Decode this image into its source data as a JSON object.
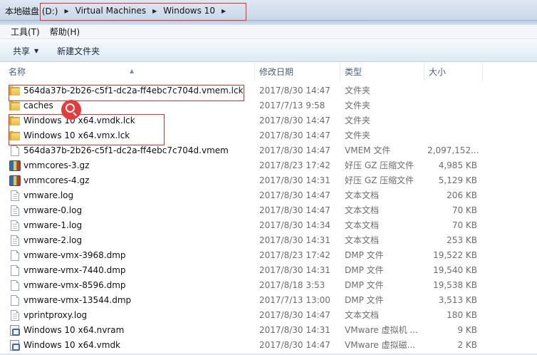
{
  "address": {
    "crumbs": [
      "本地磁盘 (D:)",
      "Virtual Machines",
      "Windows 10"
    ]
  },
  "menu": {
    "items": [
      "工具(T)",
      "帮助(H)"
    ]
  },
  "toolbar": {
    "share_label": "共享",
    "new_folder_label": "新建文件夹"
  },
  "columns": {
    "name": "名称",
    "date": "修改日期",
    "type": "类型",
    "size": "大小"
  },
  "files": [
    {
      "name": "564da37b-2b26-c5f1-dc2a-ff4ebc7c704d.vmem.lck",
      "date": "2017/8/30 14:47",
      "type": "文件夹",
      "size": "",
      "icon": "folder-icon"
    },
    {
      "name": "caches",
      "date": "2017/7/13 9:58",
      "type": "文件夹",
      "size": "",
      "icon": "folder-icon"
    },
    {
      "name": "Windows 10 x64.vmdk.lck",
      "date": "2017/8/30 14:47",
      "type": "文件夹",
      "size": "",
      "icon": "folder-icon"
    },
    {
      "name": "Windows 10 x64.vmx.lck",
      "date": "2017/8/30 14:47",
      "type": "文件夹",
      "size": "",
      "icon": "folder-icon"
    },
    {
      "name": "564da37b-2b26-c5f1-dc2a-ff4ebc7c704d.vmem",
      "date": "2017/8/30 14:47",
      "type": "VMEM 文件",
      "size": "2,097,152...",
      "icon": "file-icon"
    },
    {
      "name": "vmmcores-3.gz",
      "date": "2017/8/23 17:42",
      "type": "好压 GZ 压缩文件",
      "size": "4,985 KB",
      "icon": "archive-icon"
    },
    {
      "name": "vmmcores-4.gz",
      "date": "2017/8/30 14:31",
      "type": "好压 GZ 压缩文件",
      "size": "5,129 KB",
      "icon": "archive-icon"
    },
    {
      "name": "vmware.log",
      "date": "2017/8/30 14:47",
      "type": "文本文档",
      "size": "206 KB",
      "icon": "text-file-icon"
    },
    {
      "name": "vmware-0.log",
      "date": "2017/8/30 14:47",
      "type": "文本文档",
      "size": "70 KB",
      "icon": "text-file-icon"
    },
    {
      "name": "vmware-1.log",
      "date": "2017/8/30 14:34",
      "type": "文本文档",
      "size": "70 KB",
      "icon": "text-file-icon"
    },
    {
      "name": "vmware-2.log",
      "date": "2017/8/30 14:31",
      "type": "文本文档",
      "size": "253 KB",
      "icon": "text-file-icon"
    },
    {
      "name": "vmware-vmx-3968.dmp",
      "date": "2017/8/23 17:42",
      "type": "DMP 文件",
      "size": "19,522 KB",
      "icon": "file-icon"
    },
    {
      "name": "vmware-vmx-7440.dmp",
      "date": "2017/8/30 14:31",
      "type": "DMP 文件",
      "size": "19,540 KB",
      "icon": "file-icon"
    },
    {
      "name": "vmware-vmx-8596.dmp",
      "date": "2017/8/18 3:53",
      "type": "DMP 文件",
      "size": "19,538 KB",
      "icon": "file-icon"
    },
    {
      "name": "vmware-vmx-13544.dmp",
      "date": "2017/7/13 13:00",
      "type": "DMP 文件",
      "size": "3,513 KB",
      "icon": "file-icon"
    },
    {
      "name": "vprintproxy.log",
      "date": "2017/8/30 14:47",
      "type": "文本文档",
      "size": "180 KB",
      "icon": "text-file-icon"
    },
    {
      "name": "Windows 10 x64.nvram",
      "date": "2017/8/30 14:31",
      "type": "VMware 虚拟机 ...",
      "size": "9 KB",
      "icon": "vmware-file-icon"
    },
    {
      "name": "Windows 10 x64.vmdk",
      "date": "2017/8/30 14:47",
      "type": "VMware 虚拟磁...",
      "size": "2 KB",
      "icon": "vmware-disk-icon"
    }
  ],
  "colors": {
    "highlight": "#e0302a",
    "magnifier": "#e53b3b"
  }
}
